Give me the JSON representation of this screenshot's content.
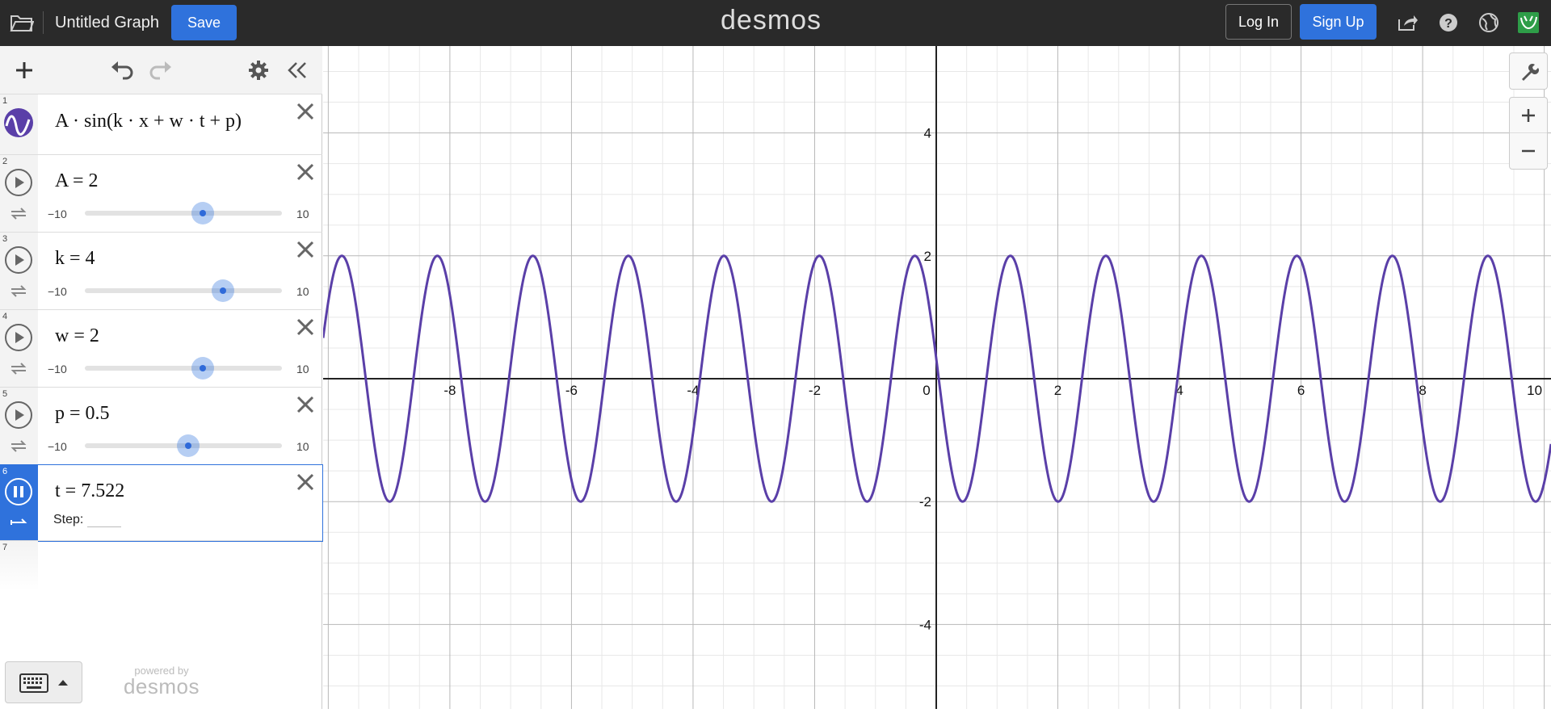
{
  "header": {
    "title": "Untitled Graph",
    "save_label": "Save",
    "logo": "desmos",
    "login_label": "Log In",
    "signup_label": "Sign Up"
  },
  "expressions": [
    {
      "index": "1",
      "latex_text": "A · sin(k · x + w · t + p)",
      "color": "#5a3fa8"
    },
    {
      "index": "2",
      "latex_text": "A = 2",
      "min": "−10",
      "max": "10",
      "value": 2
    },
    {
      "index": "3",
      "latex_text": "k = 4",
      "min": "−10",
      "max": "10",
      "value": 4
    },
    {
      "index": "4",
      "latex_text": "w = 2",
      "min": "−10",
      "max": "10",
      "value": 2
    },
    {
      "index": "5",
      "latex_text": "p = 0.5",
      "min": "−10",
      "max": "10",
      "value": 0.5
    },
    {
      "index": "6",
      "latex_text": "t = 7.522",
      "step_label": "Step:"
    },
    {
      "index": "7"
    }
  ],
  "footer": {
    "powered_by": "powered by",
    "brand": "desmos"
  },
  "graph": {
    "x_range": [
      -10,
      10
    ],
    "y_range": [
      -5.3,
      5.3
    ],
    "x_ticks": [
      "-8",
      "-6",
      "-4",
      "-2",
      "0",
      "2",
      "4",
      "6",
      "8",
      "10"
    ],
    "y_ticks": [
      "4",
      "2",
      "-2",
      "-4"
    ],
    "curve_color": "#5a3fa8",
    "function": {
      "A": 2,
      "k": 4,
      "w": 2,
      "t": 7.522,
      "p": 0.5
    }
  },
  "colors": {
    "accent": "#2f72dc",
    "header_bg": "#2a2a2a"
  }
}
